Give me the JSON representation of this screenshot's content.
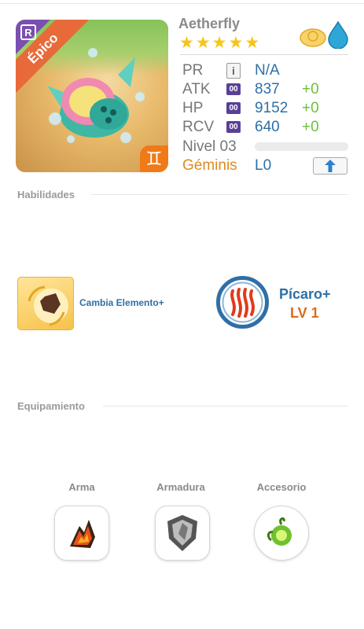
{
  "creature": {
    "name": "Aetherfly",
    "rarity_label": "Épico",
    "rarity_badge": "R",
    "zodiac_symbol": "♊",
    "star_count": 5,
    "elements": [
      "sun-cloud-icon",
      "water-drop-icon"
    ]
  },
  "stats": {
    "pr": {
      "label": "PR",
      "chip": "i",
      "value": "N/A"
    },
    "atk": {
      "label": "ATK",
      "chip": "00",
      "value": "837",
      "bonus": "+0"
    },
    "hp": {
      "label": "HP",
      "chip": "00",
      "value": "9152",
      "bonus": "+0"
    },
    "rcv": {
      "label": "RCV",
      "chip": "00",
      "value": "640",
      "bonus": "+0"
    },
    "level": {
      "label": "Nivel 03",
      "progress": 0.0
    },
    "zodiac": {
      "label": "Géminis",
      "limit": "L0"
    }
  },
  "sections": {
    "skills_title": "Habilidades",
    "equipment_title": "Equipamiento"
  },
  "skills": {
    "active": {
      "name": "Cambia Elemento+"
    },
    "leader": {
      "name": "Pícaro+",
      "level": "LV 1"
    }
  },
  "equipment": {
    "weapon": "Arma",
    "armor": "Armadura",
    "accessory": "Accesorio"
  },
  "colors": {
    "accent_blue": "#2f6fa6",
    "bonus_green": "#6cbf3a",
    "zodiac_orange": "#e08a1e",
    "rarity_orange": "#e86a3a",
    "rarity_purple": "#7a4fb0",
    "star_gold": "#f5c518"
  }
}
